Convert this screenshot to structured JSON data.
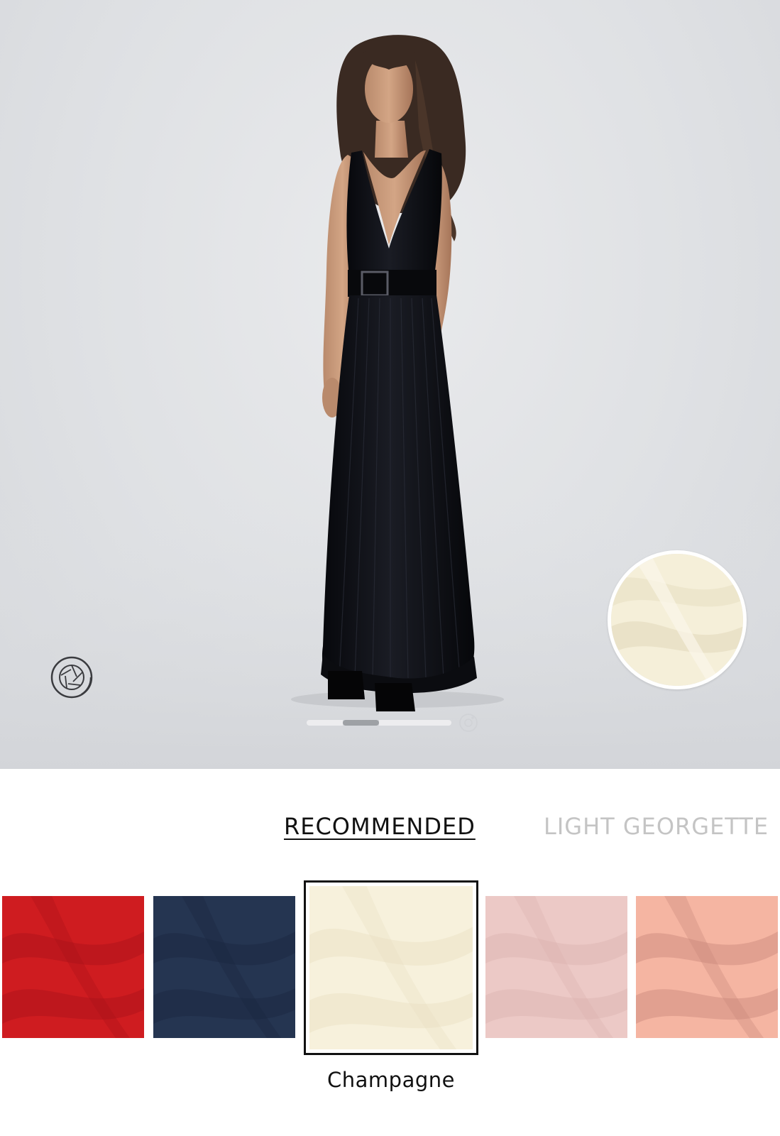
{
  "product_view": {
    "image_semantic": "model-wearing-black-pleated-gown",
    "background_color": "#e0e2e5",
    "dress_color": "#0e0f14",
    "fabric_preview_color": "#f5efd9",
    "pager": {
      "count": 4,
      "active_index": 1
    },
    "icons": {
      "aperture": "camera-aperture-icon",
      "view_360": "360-view-icon"
    }
  },
  "tabs": [
    {
      "label": "RECOMMENDED",
      "active": true
    },
    {
      "label": "LIGHT GEORGETTE",
      "active": false
    }
  ],
  "swatches": [
    {
      "color": "#cf1c20",
      "shade": "#a8121a",
      "selected": false
    },
    {
      "color": "#253551",
      "shade": "#1a2540",
      "selected": false
    },
    {
      "color": "#f7f1dc",
      "shade": "#e8dfc2",
      "selected": true
    },
    {
      "color": "#ecc9c6",
      "shade": "#dcb3b0",
      "selected": false
    },
    {
      "color": "#f5b5a2",
      "shade": "#c9877a",
      "selected": false
    }
  ],
  "selected_swatch_label": "Champagne"
}
